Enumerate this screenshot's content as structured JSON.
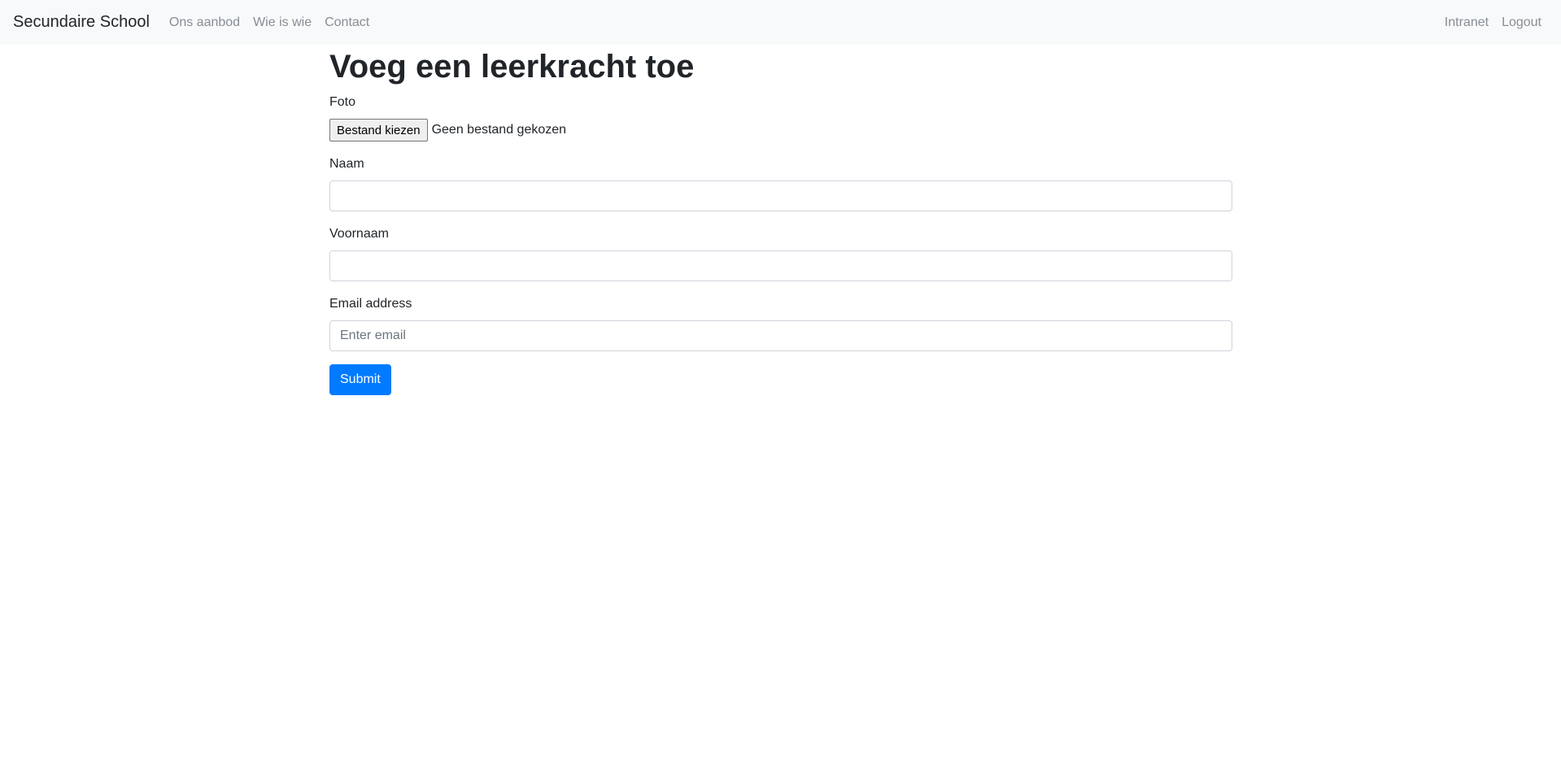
{
  "navbar": {
    "brand": "Secundaire School",
    "left_links": [
      "Ons aanbod",
      "Wie is wie",
      "Contact"
    ],
    "right_links": [
      "Intranet",
      "Logout"
    ]
  },
  "page": {
    "title": "Voeg een leerkracht toe"
  },
  "form": {
    "photo": {
      "label": "Foto",
      "button_label": "Bestand kiezen",
      "status": "Geen bestand gekozen"
    },
    "naam": {
      "label": "Naam",
      "value": ""
    },
    "voornaam": {
      "label": "Voornaam",
      "value": ""
    },
    "email": {
      "label": "Email address",
      "placeholder": "Enter email",
      "value": ""
    },
    "submit_label": "Submit"
  },
  "colors": {
    "navbar_bg": "#f8f9fa",
    "primary": "#007bff",
    "nav_link": "#868e96"
  }
}
